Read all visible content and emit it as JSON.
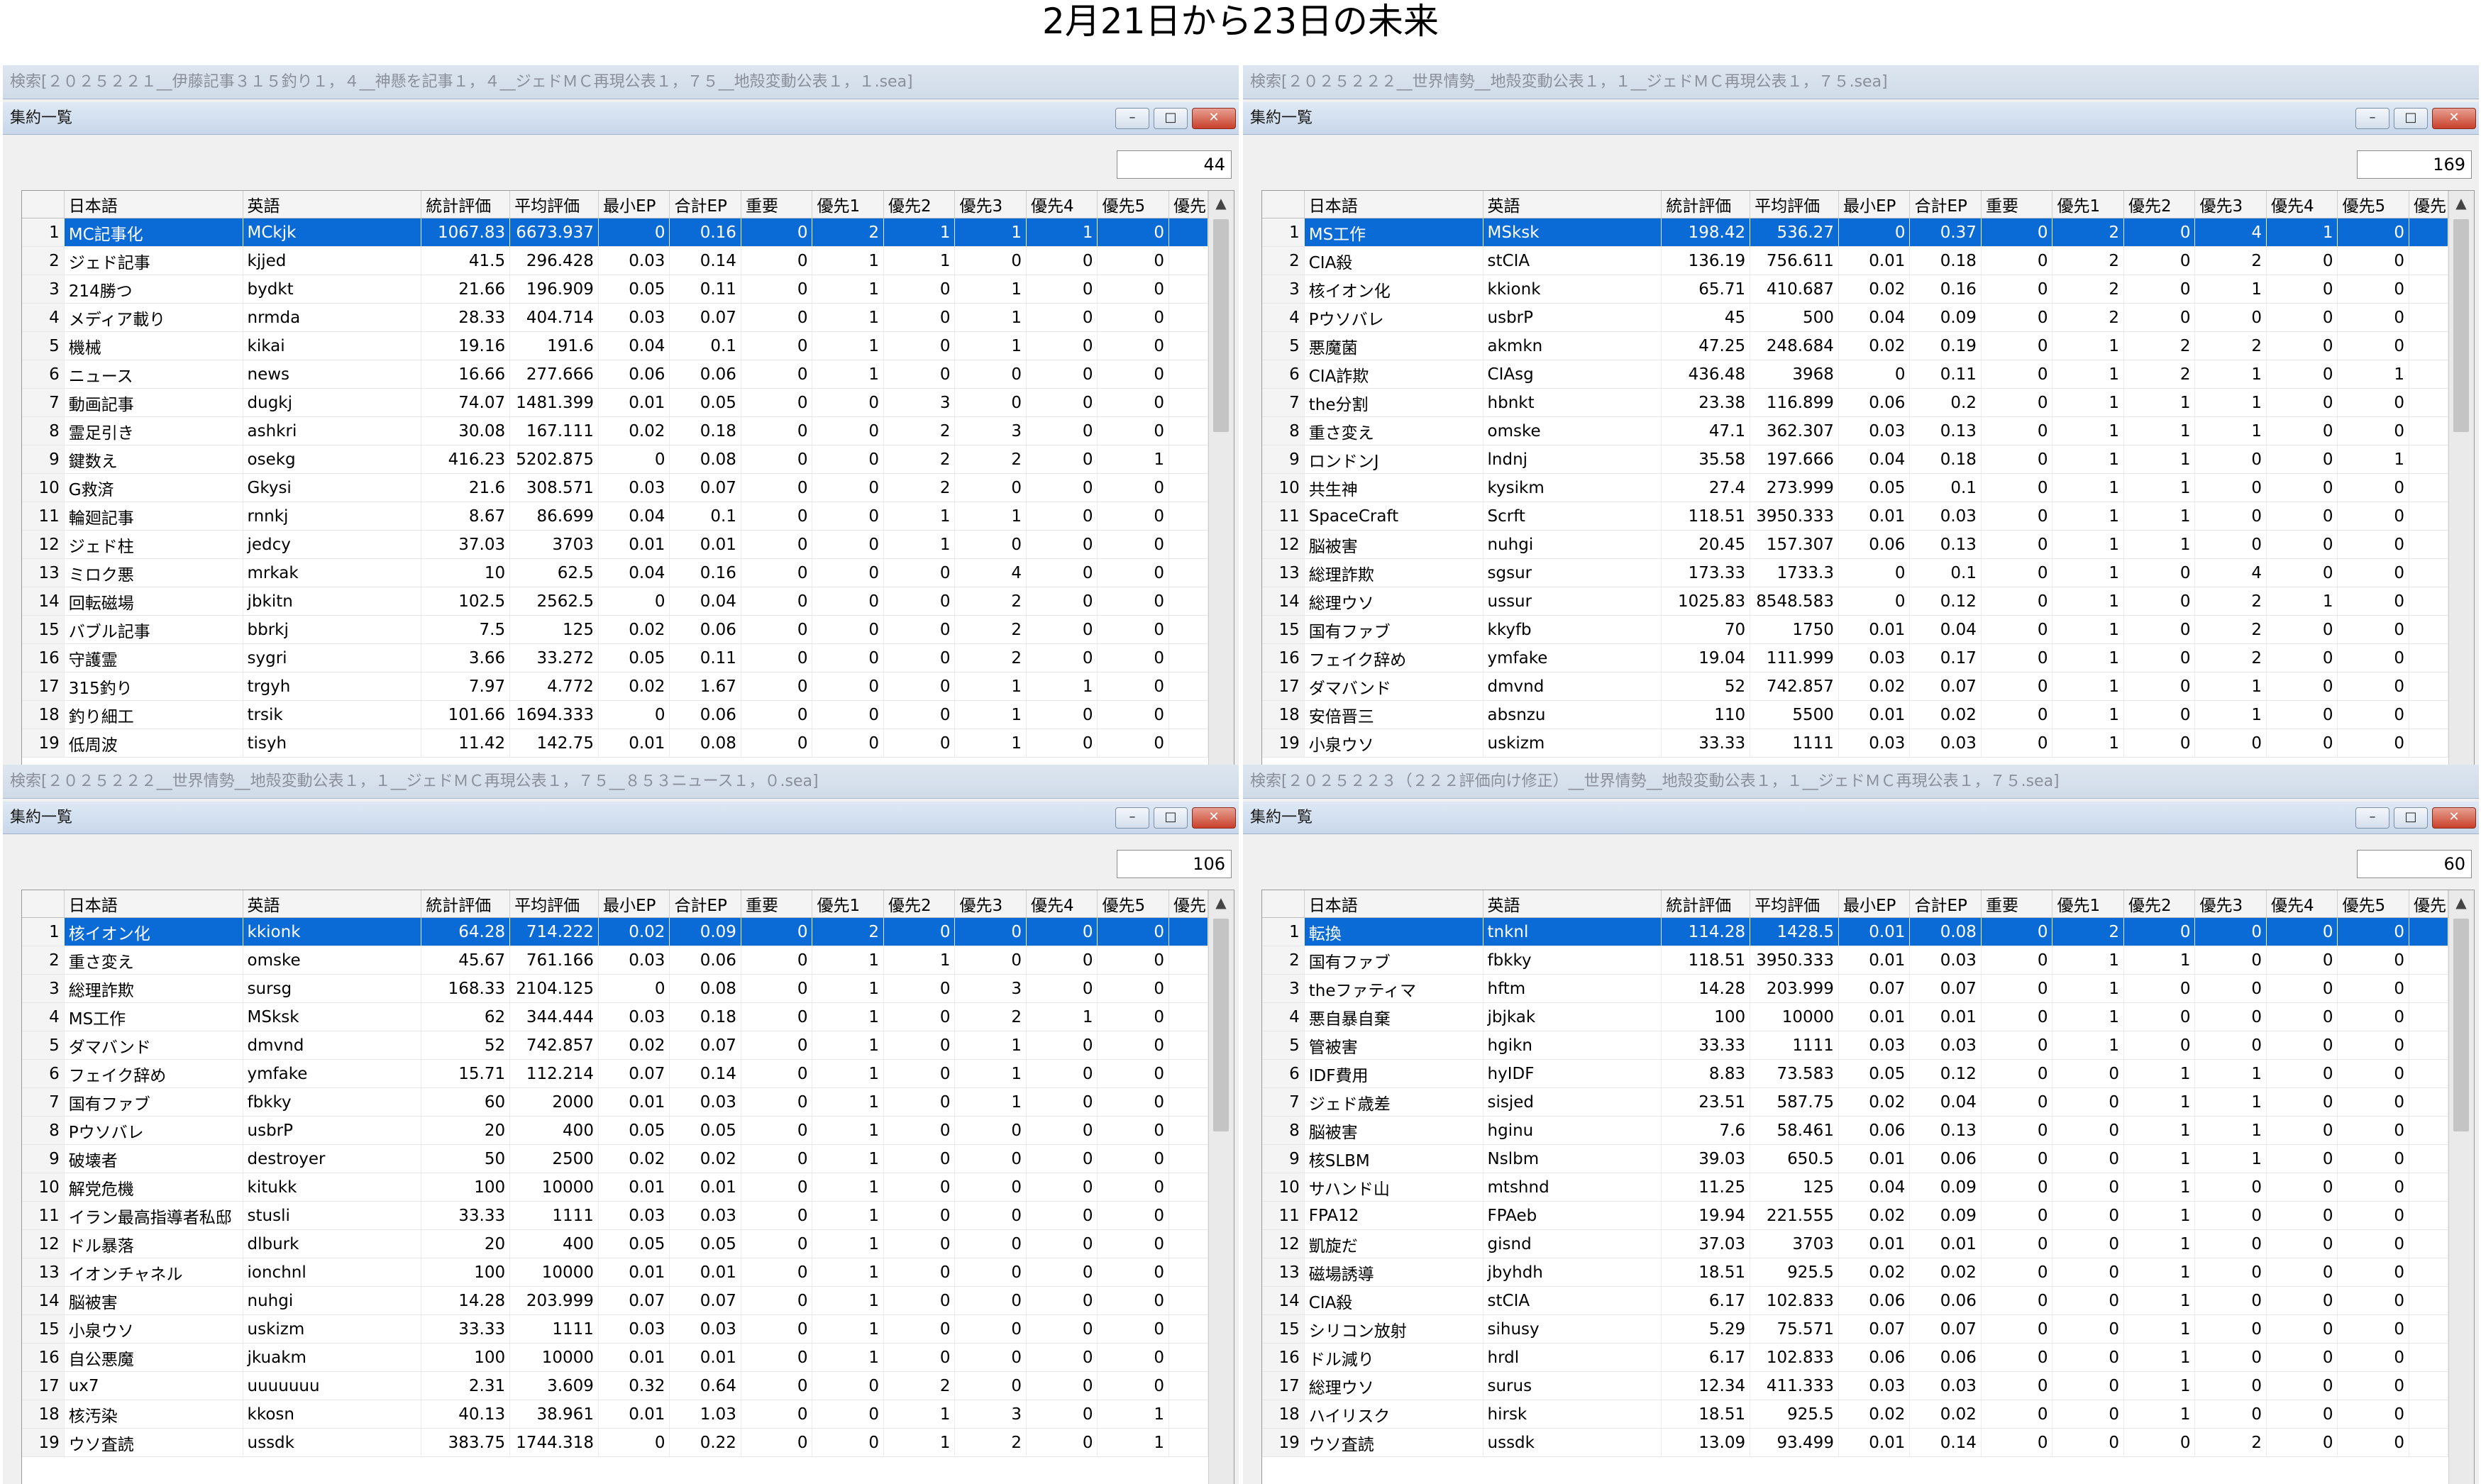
{
  "page_title": "2月21日から23日の未来",
  "columns": [
    "",
    "日本語",
    "英語",
    "統計評価",
    "平均評価",
    "最小EP",
    "合計EP",
    "重要",
    "優先1",
    "優先2",
    "優先3",
    "優先4",
    "優先5",
    "優先"
  ],
  "panes": [
    {
      "outer_title": "検索[２０２５２２１__伊藤記事３１５釣り１，４__神懸を記事１，４__ジェドＭＣ再現公表１，７５__地殻変動公表１，１.sea]",
      "inner_title": "集約一覧",
      "count": "44",
      "rows": [
        [
          "1",
          "MC記事化",
          "MCkjk",
          "1067.83",
          "6673.937",
          "0",
          "0.16",
          "0",
          "2",
          "1",
          "1",
          "1",
          "0"
        ],
        [
          "2",
          "ジェド記事",
          "kjjed",
          "41.5",
          "296.428",
          "0.03",
          "0.14",
          "0",
          "1",
          "1",
          "0",
          "0",
          "0"
        ],
        [
          "3",
          "214勝つ",
          "bydkt",
          "21.66",
          "196.909",
          "0.05",
          "0.11",
          "0",
          "1",
          "0",
          "1",
          "0",
          "0"
        ],
        [
          "4",
          "メディア載り",
          "nrmda",
          "28.33",
          "404.714",
          "0.03",
          "0.07",
          "0",
          "1",
          "0",
          "1",
          "0",
          "0"
        ],
        [
          "5",
          "機械",
          "kikai",
          "19.16",
          "191.6",
          "0.04",
          "0.1",
          "0",
          "1",
          "0",
          "1",
          "0",
          "0"
        ],
        [
          "6",
          "ニュース",
          "news",
          "16.66",
          "277.666",
          "0.06",
          "0.06",
          "0",
          "1",
          "0",
          "0",
          "0",
          "0"
        ],
        [
          "7",
          "動画記事",
          "dugkj",
          "74.07",
          "1481.399",
          "0.01",
          "0.05",
          "0",
          "0",
          "3",
          "0",
          "0",
          "0"
        ],
        [
          "8",
          "霊足引き",
          "ashkri",
          "30.08",
          "167.111",
          "0.02",
          "0.18",
          "0",
          "0",
          "2",
          "3",
          "0",
          "0"
        ],
        [
          "9",
          "鍵数え",
          "osekg",
          "416.23",
          "5202.875",
          "0",
          "0.08",
          "0",
          "0",
          "2",
          "2",
          "0",
          "1"
        ],
        [
          "10",
          "G救済",
          "Gkysi",
          "21.6",
          "308.571",
          "0.03",
          "0.07",
          "0",
          "0",
          "2",
          "0",
          "0",
          "0"
        ],
        [
          "11",
          "輪廻記事",
          "rnnkj",
          "8.67",
          "86.699",
          "0.04",
          "0.1",
          "0",
          "0",
          "1",
          "1",
          "0",
          "0"
        ],
        [
          "12",
          "ジェド柱",
          "jedcy",
          "37.03",
          "3703",
          "0.01",
          "0.01",
          "0",
          "0",
          "1",
          "0",
          "0",
          "0"
        ],
        [
          "13",
          "ミロク悪",
          "mrkak",
          "10",
          "62.5",
          "0.04",
          "0.16",
          "0",
          "0",
          "0",
          "4",
          "0",
          "0"
        ],
        [
          "14",
          "回転磁場",
          "jbkitn",
          "102.5",
          "2562.5",
          "0",
          "0.04",
          "0",
          "0",
          "0",
          "2",
          "0",
          "0"
        ],
        [
          "15",
          "バブル記事",
          "bbrkj",
          "7.5",
          "125",
          "0.02",
          "0.06",
          "0",
          "0",
          "0",
          "2",
          "0",
          "0"
        ],
        [
          "16",
          "守護霊",
          "sygri",
          "3.66",
          "33.272",
          "0.05",
          "0.11",
          "0",
          "0",
          "0",
          "2",
          "0",
          "0"
        ],
        [
          "17",
          "315釣り",
          "trgyh",
          "7.97",
          "4.772",
          "0.02",
          "1.67",
          "0",
          "0",
          "0",
          "1",
          "1",
          "0"
        ],
        [
          "18",
          "釣り細工",
          "trsik",
          "101.66",
          "1694.333",
          "0",
          "0.06",
          "0",
          "0",
          "0",
          "1",
          "0",
          "0"
        ],
        [
          "19",
          "低周波",
          "tisyh",
          "11.42",
          "142.75",
          "0.01",
          "0.08",
          "0",
          "0",
          "0",
          "1",
          "0",
          "0"
        ]
      ]
    },
    {
      "outer_title": "検索[２０２５２２２__世界情勢__地殻変動公表１，１__ジェドＭＣ再現公表１，７５.sea]",
      "inner_title": "集約一覧",
      "count": "169",
      "rows": [
        [
          "1",
          "MS工作",
          "MSksk",
          "198.42",
          "536.27",
          "0",
          "0.37",
          "0",
          "2",
          "0",
          "4",
          "1",
          "0"
        ],
        [
          "2",
          "CIA殺",
          "stCIA",
          "136.19",
          "756.611",
          "0.01",
          "0.18",
          "0",
          "2",
          "0",
          "2",
          "0",
          "0"
        ],
        [
          "3",
          "核イオン化",
          "kkionk",
          "65.71",
          "410.687",
          "0.02",
          "0.16",
          "0",
          "2",
          "0",
          "1",
          "0",
          "0"
        ],
        [
          "4",
          "Pウソバレ",
          "usbrP",
          "45",
          "500",
          "0.04",
          "0.09",
          "0",
          "2",
          "0",
          "0",
          "0",
          "0"
        ],
        [
          "5",
          "悪魔菌",
          "akmkn",
          "47.25",
          "248.684",
          "0.02",
          "0.19",
          "0",
          "1",
          "2",
          "2",
          "0",
          "0"
        ],
        [
          "6",
          "CIA詐欺",
          "CIAsg",
          "436.48",
          "3968",
          "0",
          "0.11",
          "0",
          "1",
          "2",
          "1",
          "0",
          "1"
        ],
        [
          "7",
          "the分割",
          "hbnkt",
          "23.38",
          "116.899",
          "0.06",
          "0.2",
          "0",
          "1",
          "1",
          "1",
          "0",
          "0"
        ],
        [
          "8",
          "重さ変え",
          "omske",
          "47.1",
          "362.307",
          "0.03",
          "0.13",
          "0",
          "1",
          "1",
          "1",
          "0",
          "0"
        ],
        [
          "9",
          "ロンドンJ",
          "lndnj",
          "35.58",
          "197.666",
          "0.04",
          "0.18",
          "0",
          "1",
          "1",
          "0",
          "0",
          "1"
        ],
        [
          "10",
          "共生神",
          "kysikm",
          "27.4",
          "273.999",
          "0.05",
          "0.1",
          "0",
          "1",
          "1",
          "0",
          "0",
          "0"
        ],
        [
          "11",
          "SpaceCraft",
          "Scrft",
          "118.51",
          "3950.333",
          "0.01",
          "0.03",
          "0",
          "1",
          "1",
          "0",
          "0",
          "0"
        ],
        [
          "12",
          "脳被害",
          "nuhgi",
          "20.45",
          "157.307",
          "0.06",
          "0.13",
          "0",
          "1",
          "1",
          "0",
          "0",
          "0"
        ],
        [
          "13",
          "総理詐欺",
          "sgsur",
          "173.33",
          "1733.3",
          "0",
          "0.1",
          "0",
          "1",
          "0",
          "4",
          "0",
          "0"
        ],
        [
          "14",
          "総理ウソ",
          "ussur",
          "1025.83",
          "8548.583",
          "0",
          "0.12",
          "0",
          "1",
          "0",
          "2",
          "1",
          "0"
        ],
        [
          "15",
          "国有ファブ",
          "kkyfb",
          "70",
          "1750",
          "0.01",
          "0.04",
          "0",
          "1",
          "0",
          "2",
          "0",
          "0"
        ],
        [
          "16",
          "フェイク辞め",
          "ymfake",
          "19.04",
          "111.999",
          "0.03",
          "0.17",
          "0",
          "1",
          "0",
          "2",
          "0",
          "0"
        ],
        [
          "17",
          "ダマバンド",
          "dmvnd",
          "52",
          "742.857",
          "0.02",
          "0.07",
          "0",
          "1",
          "0",
          "1",
          "0",
          "0"
        ],
        [
          "18",
          "安倍晋三",
          "absnzu",
          "110",
          "5500",
          "0.01",
          "0.02",
          "0",
          "1",
          "0",
          "1",
          "0",
          "0"
        ],
        [
          "19",
          "小泉ウソ",
          "uskizm",
          "33.33",
          "1111",
          "0.03",
          "0.03",
          "0",
          "1",
          "0",
          "0",
          "0",
          "0"
        ]
      ]
    },
    {
      "outer_title": "検索[２０２５２２２__世界情勢__地殻変動公表１，１__ジェドＭＣ再現公表１，７５__８５３ニュース１，０.sea]",
      "inner_title": "集約一覧",
      "count": "106",
      "rows": [
        [
          "1",
          "核イオン化",
          "kkionk",
          "64.28",
          "714.222",
          "0.02",
          "0.09",
          "0",
          "2",
          "0",
          "0",
          "0",
          "0"
        ],
        [
          "2",
          "重さ変え",
          "omske",
          "45.67",
          "761.166",
          "0.03",
          "0.06",
          "0",
          "1",
          "1",
          "0",
          "0",
          "0"
        ],
        [
          "3",
          "総理詐欺",
          "sursg",
          "168.33",
          "2104.125",
          "0",
          "0.08",
          "0",
          "1",
          "0",
          "3",
          "0",
          "0"
        ],
        [
          "4",
          "MS工作",
          "MSksk",
          "62",
          "344.444",
          "0.03",
          "0.18",
          "0",
          "1",
          "0",
          "2",
          "1",
          "0"
        ],
        [
          "5",
          "ダマバンド",
          "dmvnd",
          "52",
          "742.857",
          "0.02",
          "0.07",
          "0",
          "1",
          "0",
          "1",
          "0",
          "0"
        ],
        [
          "6",
          "フェイク辞め",
          "ymfake",
          "15.71",
          "112.214",
          "0.07",
          "0.14",
          "0",
          "1",
          "0",
          "1",
          "0",
          "0"
        ],
        [
          "7",
          "国有ファブ",
          "fbkky",
          "60",
          "2000",
          "0.01",
          "0.03",
          "0",
          "1",
          "0",
          "1",
          "0",
          "0"
        ],
        [
          "8",
          "Pウソバレ",
          "usbrP",
          "20",
          "400",
          "0.05",
          "0.05",
          "0",
          "1",
          "0",
          "0",
          "0",
          "0"
        ],
        [
          "9",
          "破壊者",
          "destroyer",
          "50",
          "2500",
          "0.02",
          "0.02",
          "0",
          "1",
          "0",
          "0",
          "0",
          "0"
        ],
        [
          "10",
          "解党危機",
          "kitukk",
          "100",
          "10000",
          "0.01",
          "0.01",
          "0",
          "1",
          "0",
          "0",
          "0",
          "0"
        ],
        [
          "11",
          "イラン最高指導者私邸",
          "stusli",
          "33.33",
          "1111",
          "0.03",
          "0.03",
          "0",
          "1",
          "0",
          "0",
          "0",
          "0"
        ],
        [
          "12",
          "ドル暴落",
          "dlburk",
          "20",
          "400",
          "0.05",
          "0.05",
          "0",
          "1",
          "0",
          "0",
          "0",
          "0"
        ],
        [
          "13",
          "イオンチャネル",
          "ionchnl",
          "100",
          "10000",
          "0.01",
          "0.01",
          "0",
          "1",
          "0",
          "0",
          "0",
          "0"
        ],
        [
          "14",
          "脳被害",
          "nuhgi",
          "14.28",
          "203.999",
          "0.07",
          "0.07",
          "0",
          "1",
          "0",
          "0",
          "0",
          "0"
        ],
        [
          "15",
          "小泉ウソ",
          "uskizm",
          "33.33",
          "1111",
          "0.03",
          "0.03",
          "0",
          "1",
          "0",
          "0",
          "0",
          "0"
        ],
        [
          "16",
          "自公悪魔",
          "jkuakm",
          "100",
          "10000",
          "0.01",
          "0.01",
          "0",
          "1",
          "0",
          "0",
          "0",
          "0"
        ],
        [
          "17",
          "ux7",
          "uuuuuuu",
          "2.31",
          "3.609",
          "0.32",
          "0.64",
          "0",
          "0",
          "2",
          "0",
          "0",
          "0"
        ],
        [
          "18",
          "核汚染",
          "kkosn",
          "40.13",
          "38.961",
          "0.01",
          "1.03",
          "0",
          "0",
          "1",
          "3",
          "0",
          "1"
        ],
        [
          "19",
          "ウソ査読",
          "ussdk",
          "383.75",
          "1744.318",
          "0",
          "0.22",
          "0",
          "0",
          "1",
          "2",
          "0",
          "1"
        ]
      ]
    },
    {
      "outer_title": "検索[２０２５２２３（２２２評価向け修正）__世界情勢__地殻変動公表１，１__ジェドＭＣ再現公表１，７５.sea]",
      "inner_title": "集約一覧",
      "count": "60",
      "rows": [
        [
          "1",
          "転換",
          "tnknl",
          "114.28",
          "1428.5",
          "0.01",
          "0.08",
          "0",
          "2",
          "0",
          "0",
          "0",
          "0"
        ],
        [
          "2",
          "国有ファブ",
          "fbkky",
          "118.51",
          "3950.333",
          "0.01",
          "0.03",
          "0",
          "1",
          "1",
          "0",
          "0",
          "0"
        ],
        [
          "3",
          "theファティマ",
          "hftm",
          "14.28",
          "203.999",
          "0.07",
          "0.07",
          "0",
          "1",
          "0",
          "0",
          "0",
          "0"
        ],
        [
          "4",
          "悪自暴自棄",
          "jbjkak",
          "100",
          "10000",
          "0.01",
          "0.01",
          "0",
          "1",
          "0",
          "0",
          "0",
          "0"
        ],
        [
          "5",
          "管被害",
          "hgikn",
          "33.33",
          "1111",
          "0.03",
          "0.03",
          "0",
          "1",
          "0",
          "0",
          "0",
          "0"
        ],
        [
          "6",
          "IDF費用",
          "hyIDF",
          "8.83",
          "73.583",
          "0.05",
          "0.12",
          "0",
          "0",
          "1",
          "1",
          "0",
          "0"
        ],
        [
          "7",
          "ジェド歳差",
          "sisjed",
          "23.51",
          "587.75",
          "0.02",
          "0.04",
          "0",
          "0",
          "1",
          "1",
          "0",
          "0"
        ],
        [
          "8",
          "脳被害",
          "hginu",
          "7.6",
          "58.461",
          "0.06",
          "0.13",
          "0",
          "0",
          "1",
          "1",
          "0",
          "0"
        ],
        [
          "9",
          "核SLBM",
          "Nslbm",
          "39.03",
          "650.5",
          "0.01",
          "0.06",
          "0",
          "0",
          "1",
          "1",
          "0",
          "0"
        ],
        [
          "10",
          "サハンド山",
          "mtshnd",
          "11.25",
          "125",
          "0.04",
          "0.09",
          "0",
          "0",
          "1",
          "0",
          "0",
          "0"
        ],
        [
          "11",
          "FPA12",
          "FPAeb",
          "19.94",
          "221.555",
          "0.02",
          "0.09",
          "0",
          "0",
          "1",
          "0",
          "0",
          "0"
        ],
        [
          "12",
          "凱旋だ",
          "gisnd",
          "37.03",
          "3703",
          "0.01",
          "0.01",
          "0",
          "0",
          "1",
          "0",
          "0",
          "0"
        ],
        [
          "13",
          "磁場誘導",
          "jbyhdh",
          "18.51",
          "925.5",
          "0.02",
          "0.02",
          "0",
          "0",
          "1",
          "0",
          "0",
          "0"
        ],
        [
          "14",
          "CIA殺",
          "stCIA",
          "6.17",
          "102.833",
          "0.06",
          "0.06",
          "0",
          "0",
          "1",
          "0",
          "0",
          "0"
        ],
        [
          "15",
          "シリコン放射",
          "sihusy",
          "5.29",
          "75.571",
          "0.07",
          "0.07",
          "0",
          "0",
          "1",
          "0",
          "0",
          "0"
        ],
        [
          "16",
          "ドル減り",
          "hrdl",
          "6.17",
          "102.833",
          "0.06",
          "0.06",
          "0",
          "0",
          "1",
          "0",
          "0",
          "0"
        ],
        [
          "17",
          "総理ウソ",
          "surus",
          "12.34",
          "411.333",
          "0.03",
          "0.03",
          "0",
          "0",
          "1",
          "0",
          "0",
          "0"
        ],
        [
          "18",
          "ハイリスク",
          "hirsk",
          "18.51",
          "925.5",
          "0.02",
          "0.02",
          "0",
          "0",
          "1",
          "0",
          "0",
          "0"
        ],
        [
          "19",
          "ウソ査読",
          "ussdk",
          "13.09",
          "93.499",
          "0.01",
          "0.14",
          "0",
          "0",
          "0",
          "2",
          "0",
          "0"
        ]
      ]
    }
  ]
}
